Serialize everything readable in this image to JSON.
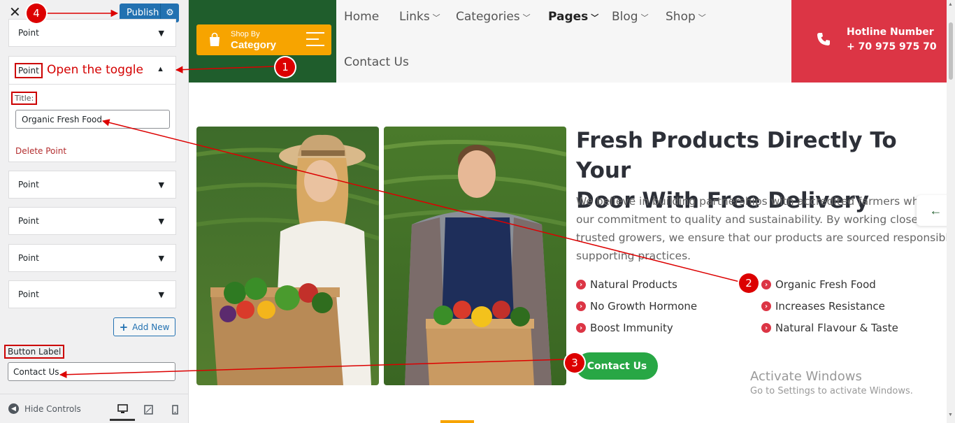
{
  "panel": {
    "close": "✕",
    "publish_label": "Publish",
    "points": [
      "Point",
      "Point",
      "Point",
      "Point",
      "Point",
      "Point"
    ],
    "open_point": {
      "label": "Point",
      "title_label": "Title:",
      "title_value": "Organic Fresh Food",
      "delete_label": "Delete Point"
    },
    "add_new_label": "Add New",
    "button_label_heading": "Button Label",
    "button_label_value": "Contact Us",
    "hide_controls": "Hide Controls"
  },
  "site": {
    "shop_by": "Shop By",
    "category": "Category",
    "nav": [
      {
        "label": "Home",
        "dropdown": false
      },
      {
        "label": "Links",
        "dropdown": true
      },
      {
        "label": "Categories",
        "dropdown": true
      },
      {
        "label": "Pages",
        "dropdown": true,
        "active": true
      },
      {
        "label": "Blog",
        "dropdown": true
      },
      {
        "label": "Shop",
        "dropdown": true
      },
      {
        "label": "Contact Us",
        "dropdown": false
      }
    ],
    "hotline_title": "Hotline Number",
    "hotline_number": "+ 70 975 975 70",
    "headline_line1": "Fresh Products Directly To Your",
    "headline_line2": "Door With Free Delivery",
    "paragraph": [
      "We believe in building partnerships with accredited farmers who sho",
      "our commitment to quality and sustainability. By working closely wit",
      "trusted growers, we ensure that our products are sourced responsibly,",
      "supporting practices."
    ],
    "features_left": [
      "Natural Products",
      "No Growth Hormone",
      "Boost Immunity"
    ],
    "features_right": [
      "Organic Fresh Food",
      "Increases Resistance",
      "Natural Flavour & Taste"
    ],
    "contact_button": "Contact Us",
    "watermark_title": "Activate Windows",
    "watermark_sub": "Go to Settings to activate Windows."
  },
  "annotations": {
    "step1": "1",
    "step2": "2",
    "step3": "3",
    "step4": "4",
    "open_toggle_text": "Open the toggle",
    "color": "#dc0000"
  },
  "colors": {
    "brand_green": "#1f5d2c",
    "accent_orange": "#f7a400",
    "hotline_red": "#dc3545",
    "button_green": "#28a745",
    "wp_blue": "#2271b1"
  },
  "icons": [
    "close-icon",
    "gear-icon",
    "caret-down-icon",
    "caret-up-icon",
    "plus-icon",
    "phone-icon",
    "shopping-bag-icon",
    "menu-icon",
    "arrow-circle-right-icon",
    "arrow-left-icon",
    "desktop-icon",
    "tablet-icon",
    "mobile-icon"
  ]
}
